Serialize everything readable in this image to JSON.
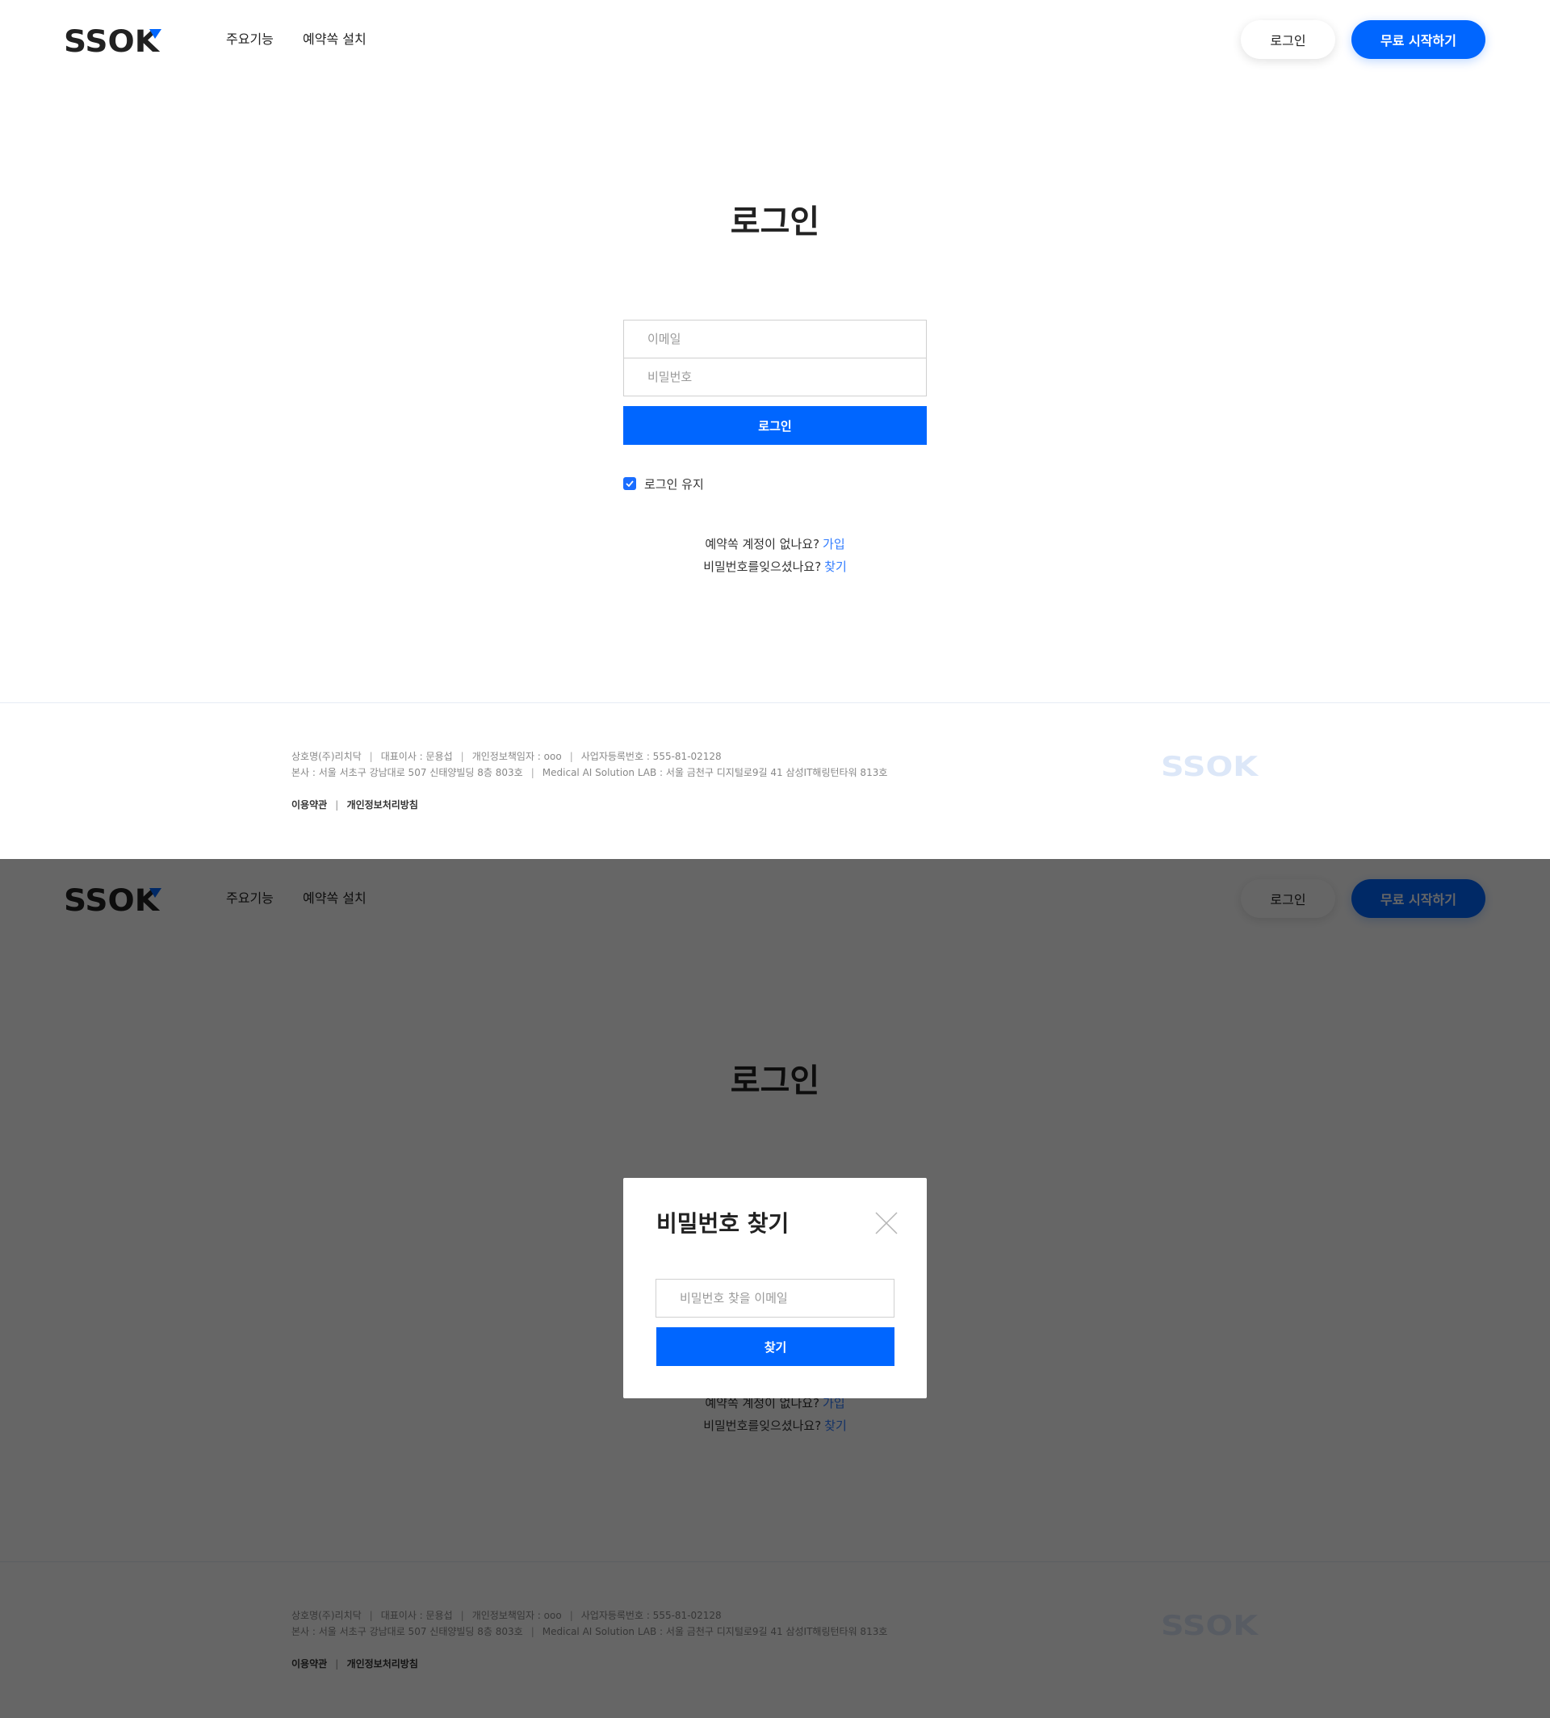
{
  "colors": {
    "primary": "#0066ff",
    "link": "#2f7bff",
    "text": "#222222",
    "footer_text": "#888888",
    "overlay": "rgba(0,0,0,0.6)"
  },
  "header": {
    "logo_text": "SSOK",
    "nav": [
      {
        "label": "주요기능"
      },
      {
        "label": "예약쏙 설치"
      }
    ],
    "login_label": "로그인",
    "start_label": "무료 시작하기"
  },
  "login": {
    "title": "로그인",
    "email_placeholder": "이메일",
    "password_placeholder": "비밀번호",
    "submit_label": "로그인",
    "keep_label": "로그인 유지",
    "keep_checked": true,
    "signup_prompt": "예약쏙 계정이 없나요?",
    "signup_link": "가입",
    "find_prompt": "비밀번호를잊으셨나요?",
    "find_link": "찾기"
  },
  "footer": {
    "company": "상호명(주)리치닥",
    "ceo": "대표이사 : 문용섭",
    "privacy_officer": "개인정보책임자 : ooo",
    "biz_number": "사업자등록번호 : 555-81-02128",
    "hq_address": "본사 : 서울 서초구 강남대로 507 신태양빌딩 8층 803호",
    "lab_address": "Medical AI Solution LAB : 서울 금천구 디지털로9길 41 삼성IT해링턴타워 813호",
    "terms_label": "이용약관",
    "privacy_label": "개인정보처리방침",
    "logo_text": "SSOK"
  },
  "modal": {
    "title": "비밀번호 찾기",
    "email_placeholder": "비밀번호 찾을 이메일",
    "submit_label": "찾기"
  }
}
